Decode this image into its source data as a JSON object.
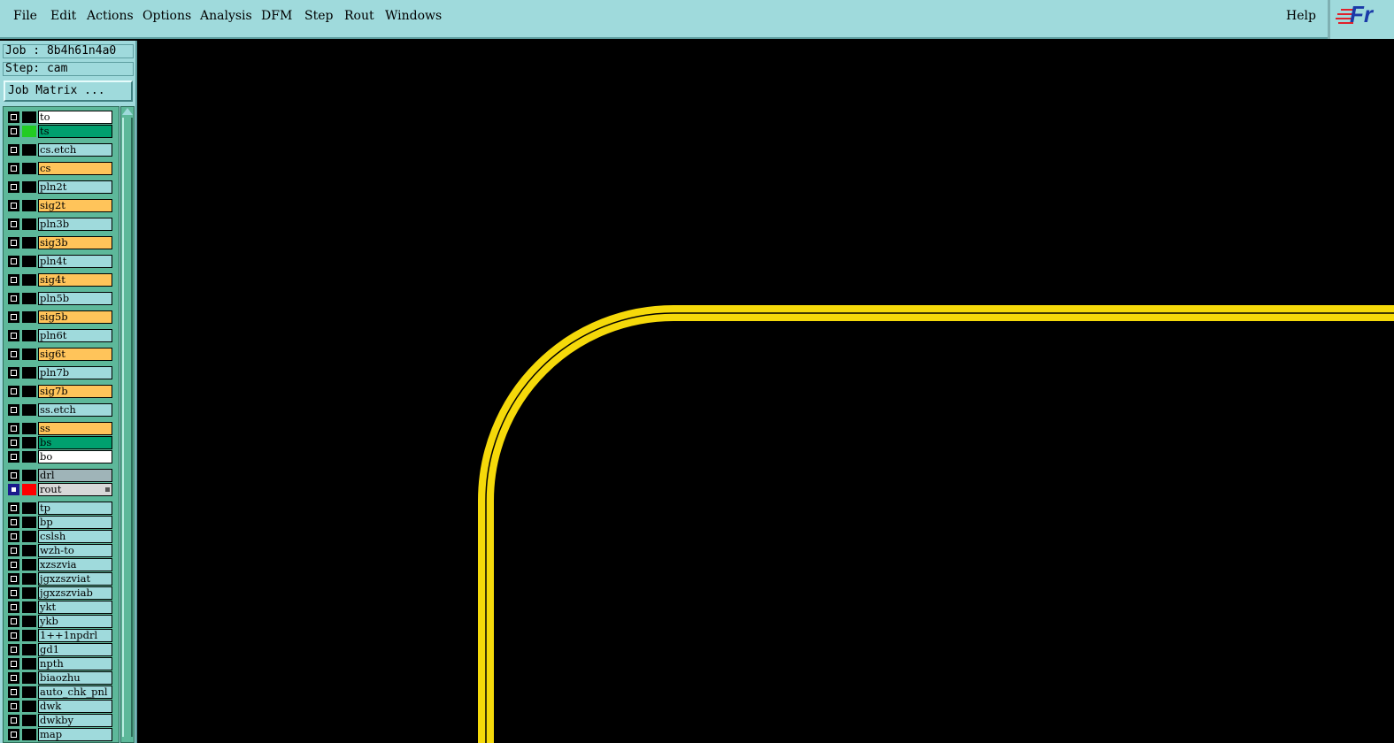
{
  "menu": {
    "items": [
      "File",
      "Edit",
      "Actions",
      "Options",
      "Analysis",
      "DFM",
      "Step",
      "Rout",
      "Windows"
    ],
    "help": "Help"
  },
  "logo": {
    "text": "Fr"
  },
  "job": {
    "job_line": "Job : 8b4h61n4a0",
    "step_line": "Step: cam"
  },
  "job_matrix_label": "Job Matrix ...",
  "colors": {
    "ui_bg": "#9fdadc",
    "layer_orange": "#ffc45a",
    "layer_green": "#00a06e",
    "layer_white": "#ffffff",
    "layer_light": "#9fdadc",
    "layer_gray": "#9fb4b8",
    "rout_highlight": "#d8d8d8",
    "rout_color": "#ff0000",
    "ts_color": "#22cc22",
    "trace_yellow": "#f5d90a"
  },
  "layers": [
    {
      "name": "to",
      "bg": "white"
    },
    {
      "name": "ts",
      "bg": "green",
      "swatch": "ts"
    },
    {
      "name": "cs.etch",
      "bg": "light"
    },
    {
      "name": "cs",
      "bg": "orange"
    },
    {
      "name": "pln2t",
      "bg": "light"
    },
    {
      "name": "sig2t",
      "bg": "orange"
    },
    {
      "name": "pln3b",
      "bg": "light"
    },
    {
      "name": "sig3b",
      "bg": "orange"
    },
    {
      "name": "pln4t",
      "bg": "light"
    },
    {
      "name": "sig4t",
      "bg": "orange"
    },
    {
      "name": "pln5b",
      "bg": "light"
    },
    {
      "name": "sig5b",
      "bg": "orange"
    },
    {
      "name": "pln6t",
      "bg": "light"
    },
    {
      "name": "sig6t",
      "bg": "orange"
    },
    {
      "name": "pln7b",
      "bg": "light"
    },
    {
      "name": "sig7b",
      "bg": "orange"
    },
    {
      "name": "ss.etch",
      "bg": "light"
    },
    {
      "name": "ss",
      "bg": "orange"
    },
    {
      "name": "bs",
      "bg": "green"
    },
    {
      "name": "bo",
      "bg": "white"
    },
    {
      "name": "drl",
      "bg": "gray"
    },
    {
      "name": "rout",
      "bg": "rout",
      "swatch": "rout",
      "active": true
    },
    {
      "name": "tp",
      "bg": "light"
    },
    {
      "name": "bp",
      "bg": "light"
    },
    {
      "name": "cslsh",
      "bg": "light"
    },
    {
      "name": "wzh-to",
      "bg": "light"
    },
    {
      "name": "xzszvia",
      "bg": "light"
    },
    {
      "name": "jgxzszviat",
      "bg": "light"
    },
    {
      "name": "jgxzszviab",
      "bg": "light"
    },
    {
      "name": "ykt",
      "bg": "light"
    },
    {
      "name": "ykb",
      "bg": "light"
    },
    {
      "name": "1++1npdrl",
      "bg": "light"
    },
    {
      "name": "gd1",
      "bg": "light"
    },
    {
      "name": "npth",
      "bg": "light"
    },
    {
      "name": "biaozhu",
      "bg": "light"
    },
    {
      "name": "auto_chk_pnl",
      "bg": "light"
    },
    {
      "name": "dwk",
      "bg": "light"
    },
    {
      "name": "dwkby",
      "bg": "light"
    },
    {
      "name": "map",
      "bg": "light"
    }
  ]
}
